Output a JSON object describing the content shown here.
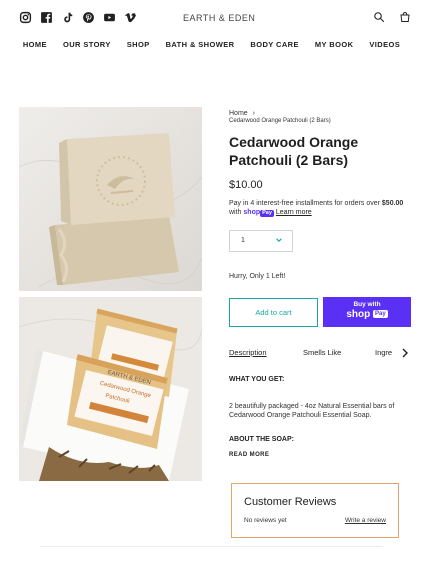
{
  "header": {
    "logo": "EARTH & EDEN",
    "social_icons": [
      "instagram-icon",
      "facebook-icon",
      "tiktok-icon",
      "pinterest-icon",
      "youtube-icon",
      "vimeo-icon"
    ],
    "utility_icons": [
      "search-icon",
      "cart-icon"
    ]
  },
  "nav": {
    "items": [
      {
        "label": "HOME"
      },
      {
        "label": "OUR STORY"
      },
      {
        "label": "SHOP"
      },
      {
        "label": "BATH & SHOWER"
      },
      {
        "label": "BODY CARE"
      },
      {
        "label": "MY BOOK"
      },
      {
        "label": "VIDEOS"
      }
    ]
  },
  "breadcrumb": {
    "home": "Home",
    "separator": "›",
    "current": "Cedarwood Orange Patchouli (2 Bars)"
  },
  "product": {
    "title": "Cedarwood Orange Patchouli (2 Bars)",
    "price": "$10.00",
    "installments_text": "Pay in 4 interest-free installments for orders over",
    "installments_amount": "$50.00",
    "installments_with": "with",
    "shop_word": "shop",
    "pay_badge": "Pay",
    "learn_more": "Learn more",
    "quantity": "1",
    "stock_text": "Hurry, Only 1 Left!",
    "add_to_cart": "Add to cart",
    "buy_with": "Buy with",
    "buy_shop": "shop",
    "buy_pay": "Pay"
  },
  "image_labels": {
    "brand": "EARTH & EDEN",
    "product_line1": "Cedarwood Orange",
    "product_line2": "Patchouli"
  },
  "tabs": [
    {
      "label": "Description",
      "active": true
    },
    {
      "label": "Smells Like",
      "active": false
    },
    {
      "label": "Ingre",
      "active": false
    }
  ],
  "description": {
    "heading1": "WHAT YOU GET:",
    "body": "2 beautifully packaged - 4oz Natural Essential bars of Cedarwood Orange Patchouli Essential Soap.",
    "heading2": "ABOUT THE SOAP:",
    "read_more": "READ MORE"
  },
  "reviews": {
    "title": "Customer Reviews",
    "none": "No reviews yet",
    "write": "Write a review"
  },
  "colors": {
    "accent_teal": "#1aa6a6",
    "shop_pay_purple": "#5a31f4",
    "review_border": "#e2a36c"
  }
}
